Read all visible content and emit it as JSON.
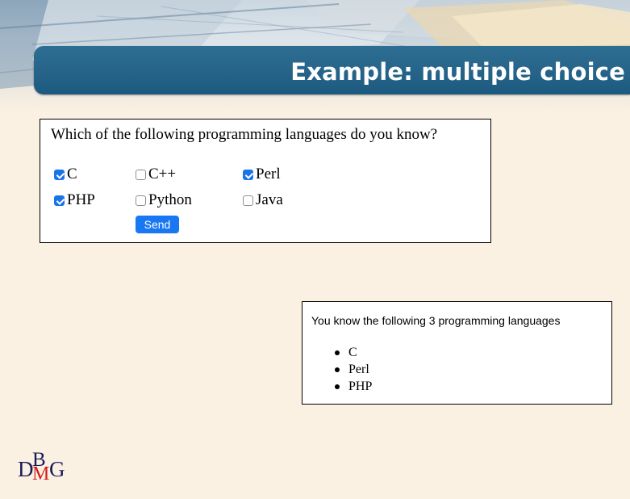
{
  "slide": {
    "title": "Example: multiple choice"
  },
  "form": {
    "question": "Which of the following programming languages do you know?",
    "options": [
      {
        "label": "C",
        "checked": true
      },
      {
        "label": "C++",
        "checked": false
      },
      {
        "label": "Perl",
        "checked": true
      },
      {
        "label": "PHP",
        "checked": true
      },
      {
        "label": "Python",
        "checked": false
      },
      {
        "label": "Java",
        "checked": false
      }
    ],
    "send_label": "Send"
  },
  "result": {
    "message": "You know the following 3 programming languages",
    "items": [
      "C",
      "Perl",
      "PHP"
    ]
  },
  "logo": {
    "letters": [
      "D",
      "B",
      "M",
      "G"
    ]
  },
  "colors": {
    "title_bar": "#1d5a80",
    "checkbox_checked": "#1a73e8",
    "send_button": "#1877f2",
    "logo_m": "#d41a1a"
  }
}
